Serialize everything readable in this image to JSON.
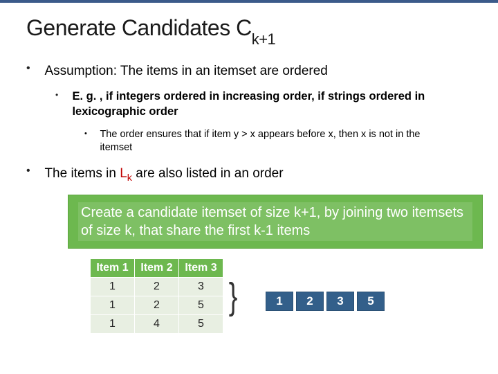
{
  "title_main": "Generate Candidates C",
  "title_sub": "k+1",
  "bullets": {
    "assumption": "Assumption: The items in an itemset are ordered",
    "eg": "E. g. , if integers ordered in increasing order, if strings ordered in lexicographic order",
    "order_note": "The order ensures that if item y > x appears before x, then x is not in the itemset",
    "items_in_lk_a": "The items in ",
    "items_in_lk_b": "L",
    "items_in_lk_sub": "k",
    "items_in_lk_c": " are also listed in an order"
  },
  "green_box": "Create a candidate itemset of size k+1, by joining two itemsets of size k, that share the first k-1 items",
  "src_table": {
    "headers": [
      "Item 1",
      "Item 2",
      "Item 3"
    ],
    "rows": [
      [
        "1",
        "2",
        "3"
      ],
      [
        "1",
        "2",
        "5"
      ],
      [
        "1",
        "4",
        "5"
      ]
    ]
  },
  "dst_row": [
    "1",
    "2",
    "3",
    "5"
  ]
}
